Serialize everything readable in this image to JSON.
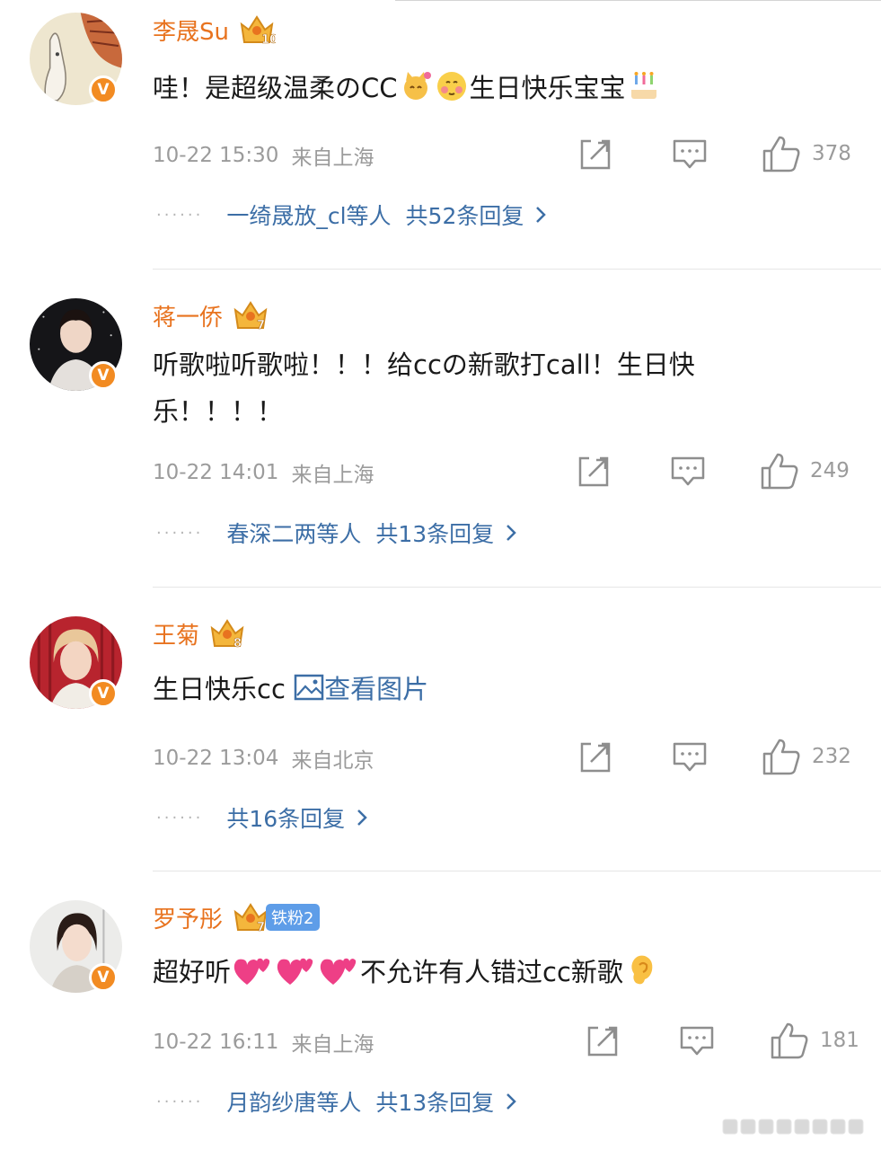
{
  "comments": [
    {
      "user": "李晟Su",
      "crown_level": "10",
      "text_parts": [
        "哇！是超级温柔のCC",
        "生日快乐宝宝"
      ],
      "emojis": [
        "cat-emoji",
        "blush-face-emoji",
        "cake-emoji"
      ],
      "date": "10-22 15:30",
      "source": "来自上海",
      "likes": "378",
      "reply_users": "一绮晟放_cl等人",
      "reply_count": "共52条回复"
    },
    {
      "user": "蒋一侨",
      "crown_level": "7",
      "text": "听歌啦听歌啦！！！给ccの新歌打call！生日快乐！！！！",
      "date": "10-22 14:01",
      "source": "来自上海",
      "likes": "249",
      "reply_users": "春深二两等人",
      "reply_count": "共13条回复"
    },
    {
      "user": "王菊",
      "crown_level": "8",
      "text": "生日快乐cc",
      "image_link": "查看图片",
      "date": "10-22 13:04",
      "source": "来自北京",
      "likes": "232",
      "reply_count": "共16条回复"
    },
    {
      "user": "罗予彤",
      "crown_level": "7",
      "fan_badge": "铁粉2",
      "text_parts": [
        "超好听",
        "不允许有人错过cc新歌"
      ],
      "emojis": [
        "two-hearts-emoji",
        "ear-emoji"
      ],
      "date": "10-22 16:11",
      "source": "来自上海",
      "likes": "181",
      "reply_users": "月韵纱唐等人",
      "reply_count": "共13条回复"
    }
  ],
  "colors": {
    "name": "#e8731f",
    "link": "#3c6ea6",
    "meta": "#9b9b9b",
    "verified_badge": "#f28b22",
    "fan_badge": "#5e9de8"
  }
}
